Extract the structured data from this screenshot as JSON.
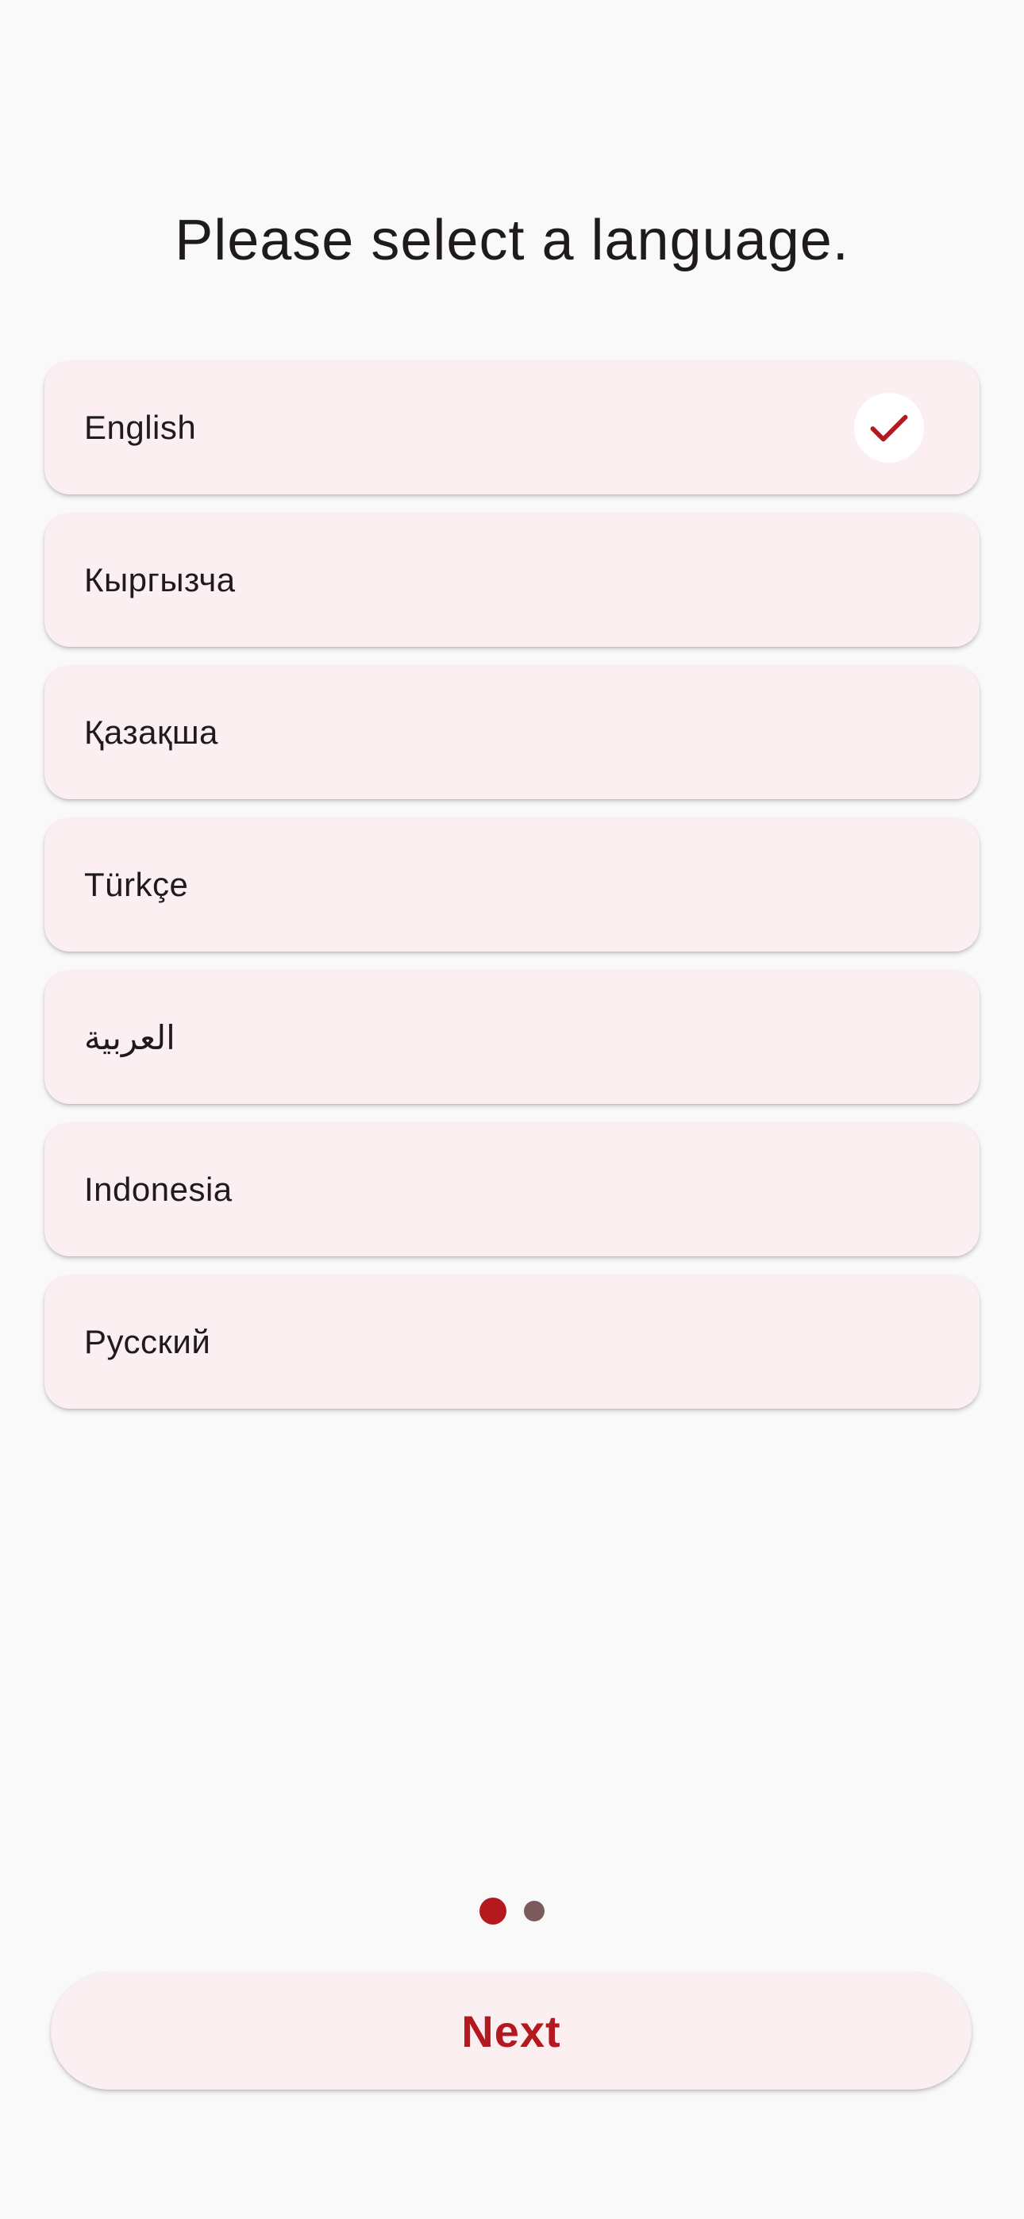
{
  "header": {
    "title": "Please select a language."
  },
  "languages": [
    {
      "label": "English",
      "selected": true
    },
    {
      "label": "Кыргызча",
      "selected": false
    },
    {
      "label": "Қазақша",
      "selected": false
    },
    {
      "label": "Türkçe",
      "selected": false
    },
    {
      "label": "العربية",
      "selected": false
    },
    {
      "label": "Indonesia",
      "selected": false
    },
    {
      "label": "Русский",
      "selected": false
    }
  ],
  "pagination": {
    "current_page": 1,
    "total_pages": 2
  },
  "footer": {
    "next_label": "Next"
  },
  "icons": {
    "selected_indicator": "checkmark-icon"
  },
  "colors": {
    "accent": "#b3191f",
    "card_background": "#fbeff2",
    "page_background": "#f9f9f9",
    "inactive_dot": "#7a5a5a"
  }
}
